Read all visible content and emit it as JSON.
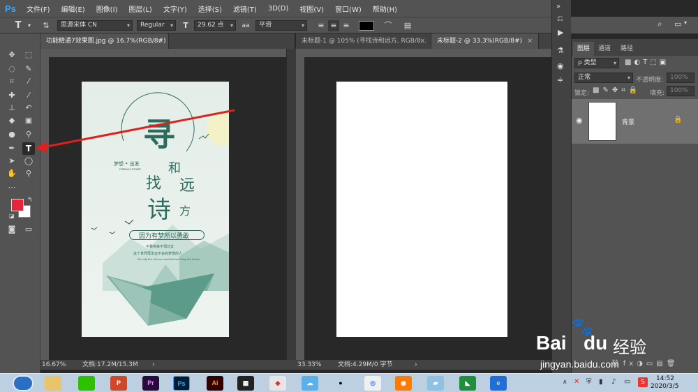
{
  "app": {
    "logo": "Ps",
    "menus": [
      "文件(F)",
      "编辑(E)",
      "图像(I)",
      "图层(L)",
      "文字(Y)",
      "选择(S)",
      "滤镜(T)",
      "3D(D)",
      "视图(V)",
      "窗口(W)",
      "帮助(H)"
    ]
  },
  "options": {
    "font_family": "思源宋体 CN",
    "font_style": "Regular",
    "font_size": "29.62 点",
    "aa_label": "aa",
    "anti_alias": "平滑",
    "text_color": "#000000"
  },
  "tabs": [
    {
      "label": "功能精通7效果图.jpg @ 16.7%(RGB/8#)",
      "close": "×"
    },
    {
      "label": "未标题-1 @ 105% (寻找诗和远方, RGB/8...",
      "close": "×"
    },
    {
      "label": "未标题-2 @ 33.3%(RGB/8#)",
      "close": "×"
    }
  ],
  "status": {
    "left_zoom": "16.67%",
    "left_doc": "文档:17.2M/15.3M",
    "right_zoom": "33.33%",
    "right_doc": "文档:4.29M/0 字节",
    "arrow": "›"
  },
  "layers_panel": {
    "tabs": [
      "图层",
      "通道",
      "路径"
    ],
    "filter_kind": "ρ 类型",
    "blend_mode": "正常",
    "opacity_label": "不透明度:",
    "opacity_value": "100%",
    "lock_label": "锁定:",
    "fill_label": "填充:",
    "fill_value": "100%",
    "layer_name": "背景"
  },
  "poster": {
    "big_char1": "寻",
    "small_he": "和",
    "zhao": "找",
    "yuan": "远",
    "shi": "诗",
    "fang": "方",
    "tag": "梦想 • 出发",
    "tag_sub": "DREAM START",
    "slogan": "因为有梦所以勇敢",
    "line1": "不畏将来不惧过去",
    "line2": "这个世界再永远不会有梦想的人",
    "line3": "We only live who are unafraid and keep the dream"
  },
  "taskbar": {
    "time": "14:52",
    "date": "2020/3/5",
    "ime": "S"
  },
  "watermark": {
    "brand": "Bai",
    "brand2": "du",
    "cn": "经验",
    "url": "jingyan.baidu.com"
  },
  "colors": {
    "foreground": "#e8243a",
    "background": "#ffffff",
    "annotation_arrow": "#e0201a"
  }
}
